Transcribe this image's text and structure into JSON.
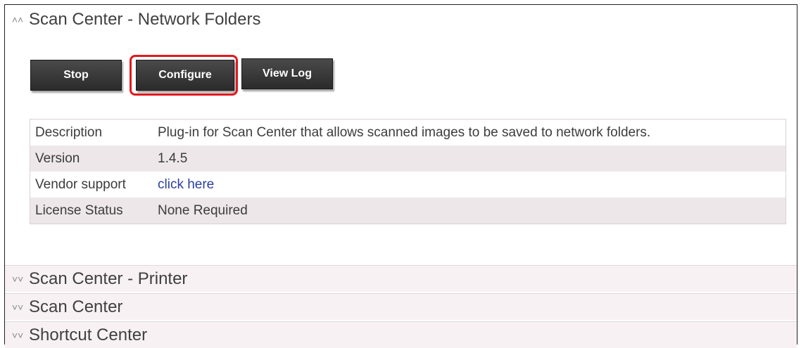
{
  "open_section": {
    "title": "Scan Center - Network Folders",
    "chevron": "double-chevron-up-icon"
  },
  "buttons": {
    "stop": "Stop",
    "configure": "Configure",
    "view_log": "View Log"
  },
  "details": [
    {
      "key": "Description",
      "value": "Plug-in for Scan Center that allows scanned images to be saved to network folders."
    },
    {
      "key": "Version",
      "value": "1.4.5"
    },
    {
      "key": "Vendor support",
      "value": "click here"
    },
    {
      "key": "License Status",
      "value": "None Required"
    }
  ],
  "collapsed_sections": [
    {
      "title": "Scan Center - Printer",
      "chevron": "double-chevron-down-icon"
    },
    {
      "title": "Scan Center",
      "chevron": "double-chevron-down-icon"
    },
    {
      "title": "Shortcut Center",
      "chevron": "double-chevron-down-icon"
    }
  ],
  "colors": {
    "highlight": "#e0191f",
    "link": "#2b3f9e",
    "button": "#333333",
    "alt_row": "#ede7e9"
  }
}
